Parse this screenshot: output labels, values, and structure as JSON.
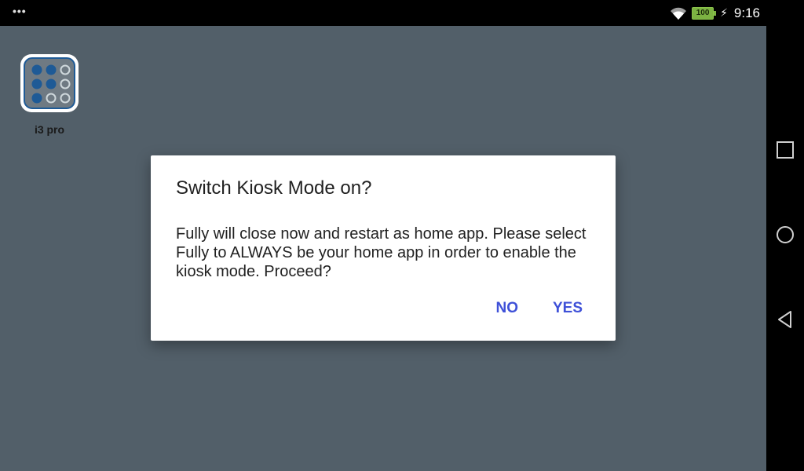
{
  "status_bar": {
    "overflow_indicator": "•••",
    "battery_level": "100",
    "time": "9:16",
    "icons": [
      "wifi-icon",
      "battery-icon",
      "charging-bolt-icon"
    ]
  },
  "home": {
    "background_color": "#525f69",
    "apps": [
      {
        "label": "i3 pro",
        "icon": "i3-pro-app-icon"
      }
    ]
  },
  "nav_bar": {
    "buttons": [
      "recents-square-icon",
      "home-circle-icon",
      "back-triangle-icon"
    ]
  },
  "dialog": {
    "title": "Switch Kiosk Mode on?",
    "message": "Fully will close now and restart as home app. Please select Fully to ALWAYS be your home app in order to enable the kiosk mode. Proceed?",
    "buttons": {
      "no": "NO",
      "yes": "YES"
    },
    "accent_color": "#3f51d8"
  }
}
